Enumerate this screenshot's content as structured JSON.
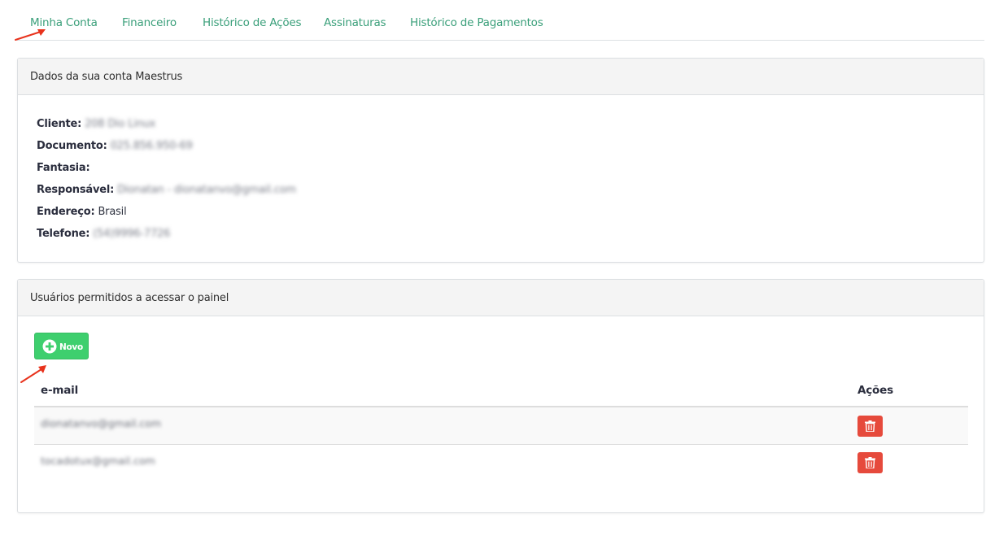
{
  "tabs": [
    {
      "label": "Minha Conta",
      "active": true
    },
    {
      "label": "Financeiro"
    },
    {
      "label": "Histórico de Ações"
    },
    {
      "label": "Assinaturas"
    },
    {
      "label": "Histórico de Pagamentos"
    }
  ],
  "account_panel": {
    "title": "Dados da sua conta Maestrus",
    "fields": [
      {
        "label": "Cliente",
        "value": "208 Dio Linux"
      },
      {
        "label": "Documento",
        "value": "025.856.950-69"
      },
      {
        "label": "Fantasia",
        "value": ""
      },
      {
        "label": "Responsável",
        "value": "Dionatan - dionatanvo@gmail.com"
      },
      {
        "label": "Endereço",
        "value": "Brasil"
      },
      {
        "label": "Telefone",
        "value": "(54)9996-7726"
      }
    ]
  },
  "users_panel": {
    "title": "Usuários permitidos a acessar o painel",
    "new_button": "Novo",
    "columns": {
      "email": "e-mail",
      "actions": "Ações"
    },
    "rows": [
      {
        "email": "dionatanvo@gmail.com"
      },
      {
        "email": "tocadotux@gmail.com"
      }
    ]
  },
  "colors": {
    "tab_link": "#3a9f7a",
    "new_button": "#3ecf6e",
    "delete_button": "#e64a3c",
    "arrow": "#e8321c"
  },
  "icons": {
    "new_button": "plus-circle-icon",
    "delete_button": "trash-icon",
    "annotation": "red-arrow-icon"
  }
}
